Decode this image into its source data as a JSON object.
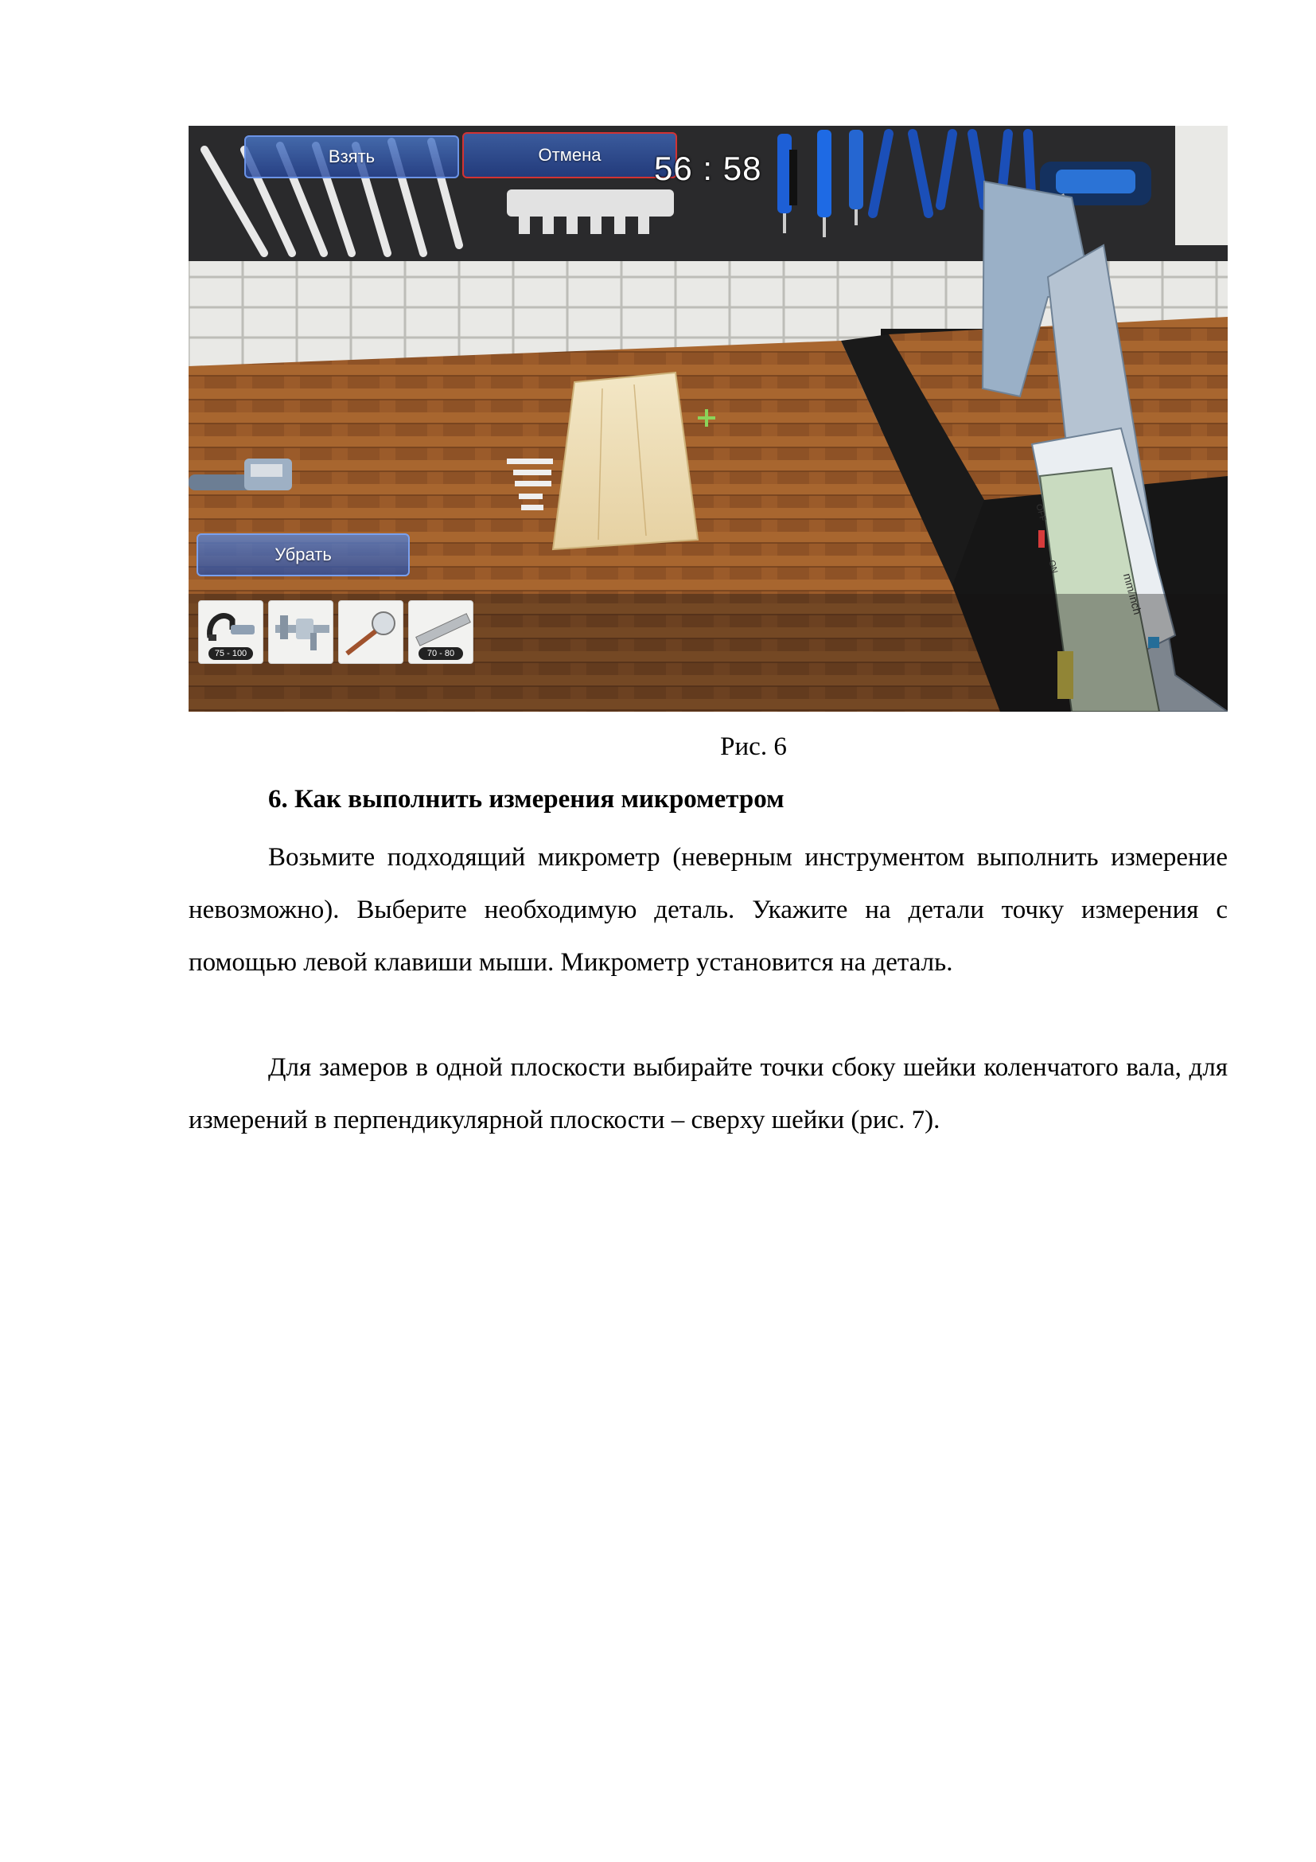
{
  "figure": {
    "take_button": "Взять",
    "cancel_button": "Отмена",
    "timer": "56 : 58",
    "remove_button": "Убрать",
    "toolbar": [
      {
        "tool": "micrometer-icon",
        "range": "75 - 100"
      },
      {
        "tool": "caliper-icon",
        "range": ""
      },
      {
        "tool": "bore-gauge-icon",
        "range": ""
      },
      {
        "tool": "ruler-icon",
        "range": "70 - 80"
      }
    ],
    "caliper_labels": {
      "off": "OFF",
      "on": "ON",
      "units": "mm/inch"
    },
    "colors": {
      "ui_button": "#3a62b5",
      "cancel_border": "#d23333",
      "crosshair": "#8bd35a"
    }
  },
  "caption": "Рис. 6",
  "heading": "6. Как выполнить измерения микрометром",
  "paragraphs": [
    "Возьмите подходящий микрометр (неверным инструментом выполнить измерение невозможно). Выберите необходимую деталь. Укажите на детали точку измерения с помощью левой клавиши мыши. Микрометр установится на деталь.",
    "Для замеров в одной плоскости выбирайте точки сбоку шейки коленчатого вала, для измерений в перпендикулярной плоскости – сверху шейки (рис. 7)."
  ]
}
